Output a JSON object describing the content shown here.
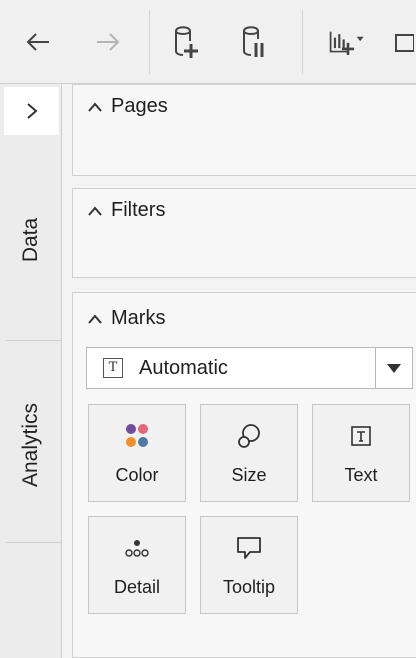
{
  "toolbar": {
    "back_icon": "arrow-left-icon",
    "forward_icon": "arrow-right-icon",
    "new_datasource_icon": "database-plus-icon",
    "pause_updates_icon": "database-pause-icon",
    "new_worksheet_icon": "new-worksheet-icon"
  },
  "rail": {
    "expand_icon": "chevron-right-icon",
    "tabs": [
      {
        "label": "Data"
      },
      {
        "label": "Analytics"
      }
    ]
  },
  "shelves": {
    "pages": {
      "title": "Pages"
    },
    "filters": {
      "title": "Filters"
    }
  },
  "marks": {
    "title": "Marks",
    "mark_type": {
      "selected": "Automatic",
      "icon": "text-mark-icon"
    },
    "buttons": [
      {
        "label": "Color",
        "icon": "color-dots-icon"
      },
      {
        "label": "Size",
        "icon": "size-shapes-icon"
      },
      {
        "label": "Text",
        "icon": "text-label-icon"
      },
      {
        "label": "Detail",
        "icon": "detail-dots-icon"
      },
      {
        "label": "Tooltip",
        "icon": "tooltip-bubble-icon"
      }
    ],
    "colors": {
      "dot_purple": "#6f4e9c",
      "dot_pink": "#e2687a",
      "dot_orange": "#f28e2b",
      "dot_blue": "#4e79a7"
    }
  }
}
